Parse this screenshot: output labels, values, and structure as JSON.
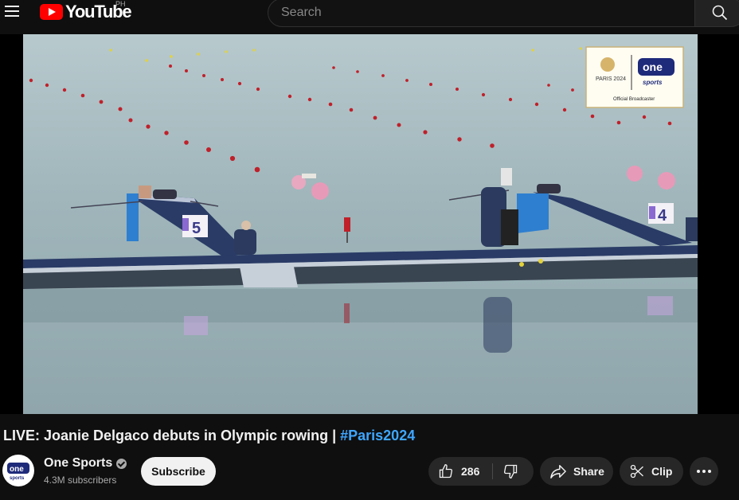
{
  "header": {
    "logo_text": "YouTube",
    "country_code": "PH",
    "search_placeholder": "Search",
    "menu_icon": "hamburger-icon",
    "search_icon": "search-icon"
  },
  "video": {
    "overlay_brand": "one",
    "overlay_brand_sub": "sports",
    "overlay_event": "PARIS 2024",
    "overlay_caption": "Official Broadcaster",
    "lane_numbers": [
      "5",
      "4"
    ]
  },
  "title": {
    "text": "LIVE: Joanie Delgaco debuts in Olympic rowing |",
    "hashtag": "#Paris2024"
  },
  "channel": {
    "name": "One Sports",
    "subscribers": "4.3M subscribers",
    "avatar_text": "one",
    "avatar_sub": "sports",
    "subscribe_label": "Subscribe"
  },
  "actions": {
    "like_count": "286",
    "share_label": "Share",
    "clip_label": "Clip"
  },
  "colors": {
    "background": "#0f0f0f",
    "brand_red": "#ff0000",
    "hashtag": "#3ea6ff",
    "pill_bg": "#272727"
  }
}
